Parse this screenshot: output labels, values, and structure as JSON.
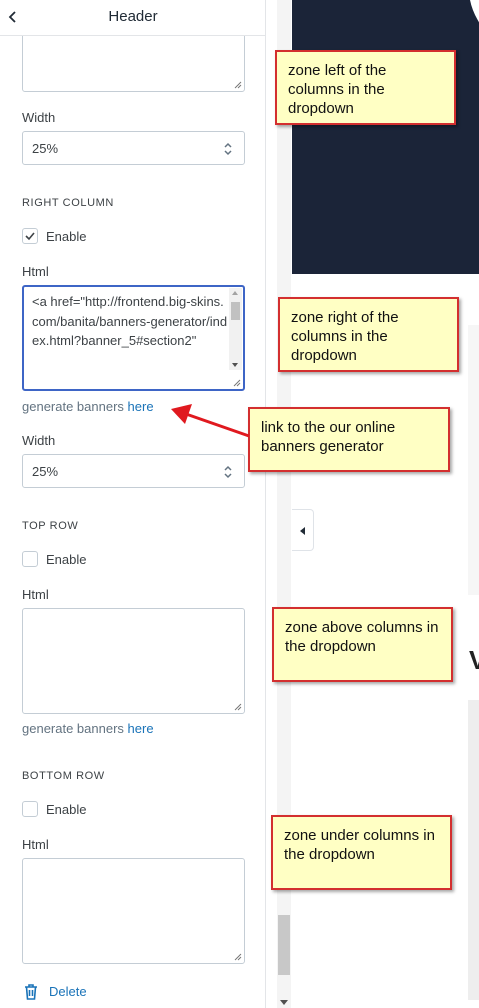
{
  "header": {
    "title": "Header"
  },
  "left_column": {
    "width_label": "Width",
    "width_value": "25%"
  },
  "right_column": {
    "section_title": "RIGHT COLUMN",
    "enable_label": "Enable",
    "enabled": true,
    "html_label": "Html",
    "html_value": "<a href=\"http://frontend.big-skins.com/banita/banners-generator/index.html?banner_5#section2\"",
    "hint_text": "generate banners",
    "hint_link": "here",
    "width_label": "Width",
    "width_value": "25%"
  },
  "top_row": {
    "section_title": "TOP ROW",
    "enable_label": "Enable",
    "enabled": false,
    "html_label": "Html",
    "hint_text": "generate banners",
    "hint_link": "here"
  },
  "bottom_row": {
    "section_title": "BOTTOM ROW",
    "enable_label": "Enable",
    "enabled": false,
    "html_label": "Html"
  },
  "footer": {
    "delete_label": "Delete"
  },
  "preview": {
    "edge_letter": "V"
  },
  "callouts": {
    "left_zone": "zone left of the columns in the dropdown",
    "right_zone": "zone right of the columns in the dropdown",
    "generator_link": "link to the our online banners generator",
    "above_zone": "zone above columns in the dropdown",
    "under_zone": "zone under columns in the dropdown"
  },
  "colors": {
    "link": "#1a73b8",
    "focus_border": "#3e65c6",
    "callout_fill": "#ffffc4",
    "callout_border": "#d32f2f",
    "arrow": "#e0191f",
    "hero_bg": "#1b2438"
  },
  "icons": [
    "chevron-left-icon",
    "select-arrows-icon",
    "checkmark-icon",
    "trash-icon",
    "resize-grip-icon",
    "collapse-arrow-icon"
  ]
}
